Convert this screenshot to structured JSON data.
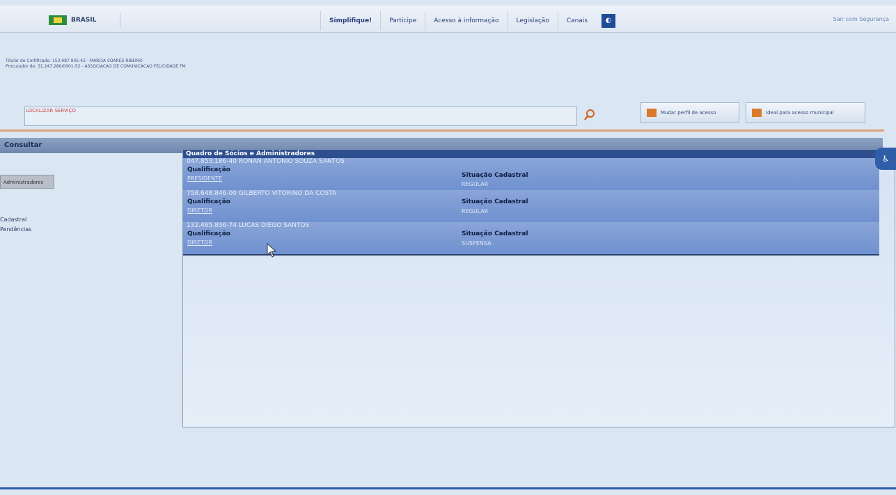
{
  "govbar": {
    "brand": "BRASIL",
    "links": [
      "Simplifique!",
      "Participe",
      "Acesso à informação",
      "Legislação",
      "Canais"
    ],
    "right_text": "Sair com Segurança"
  },
  "certificate": {
    "line1": "Titular do Certificado: 153.987.905-42 - MARCIA SOARES RIBEIRO",
    "line2": "Procurador de: 31.247.280/0001-52 - ASSOCIACAO DE COMUNICACAO FELICIDADE FM"
  },
  "search": {
    "label": "LOCALIZAR SERVIÇO",
    "value": ""
  },
  "buttons": {
    "profile": "Mudar perfil de acesso",
    "ideal": "Ideal para acesso municipal"
  },
  "section": {
    "title": "Consultar"
  },
  "leftmenu": {
    "button": "Administradores",
    "items": [
      "Cadastral",
      "Pendências"
    ]
  },
  "panel": {
    "title": "Quadro de Sócios e Administradores",
    "rows": [
      {
        "cpf_name": "047.853.186-40 RONAN ANTONIO SOUZA SANTOS",
        "qual_label": "Qualificação",
        "qual_value": "PRESIDENTE",
        "sit_label": "Situação Cadastral",
        "sit_value": "REGULAR"
      },
      {
        "cpf_name": "758.648.846-00 GILBERTO VITORINO DA COSTA",
        "qual_label": "Qualificação",
        "qual_value": "DIRETOR",
        "sit_label": "Situação Cadastral",
        "sit_value": "REGULAR"
      },
      {
        "cpf_name": "132.465.836-74 LUCAS DIEGO SANTOS",
        "qual_label": "Qualificação",
        "qual_value": "DIRETOR",
        "sit_label": "Situação Cadastral",
        "sit_value": "SUSPENSA"
      }
    ]
  }
}
